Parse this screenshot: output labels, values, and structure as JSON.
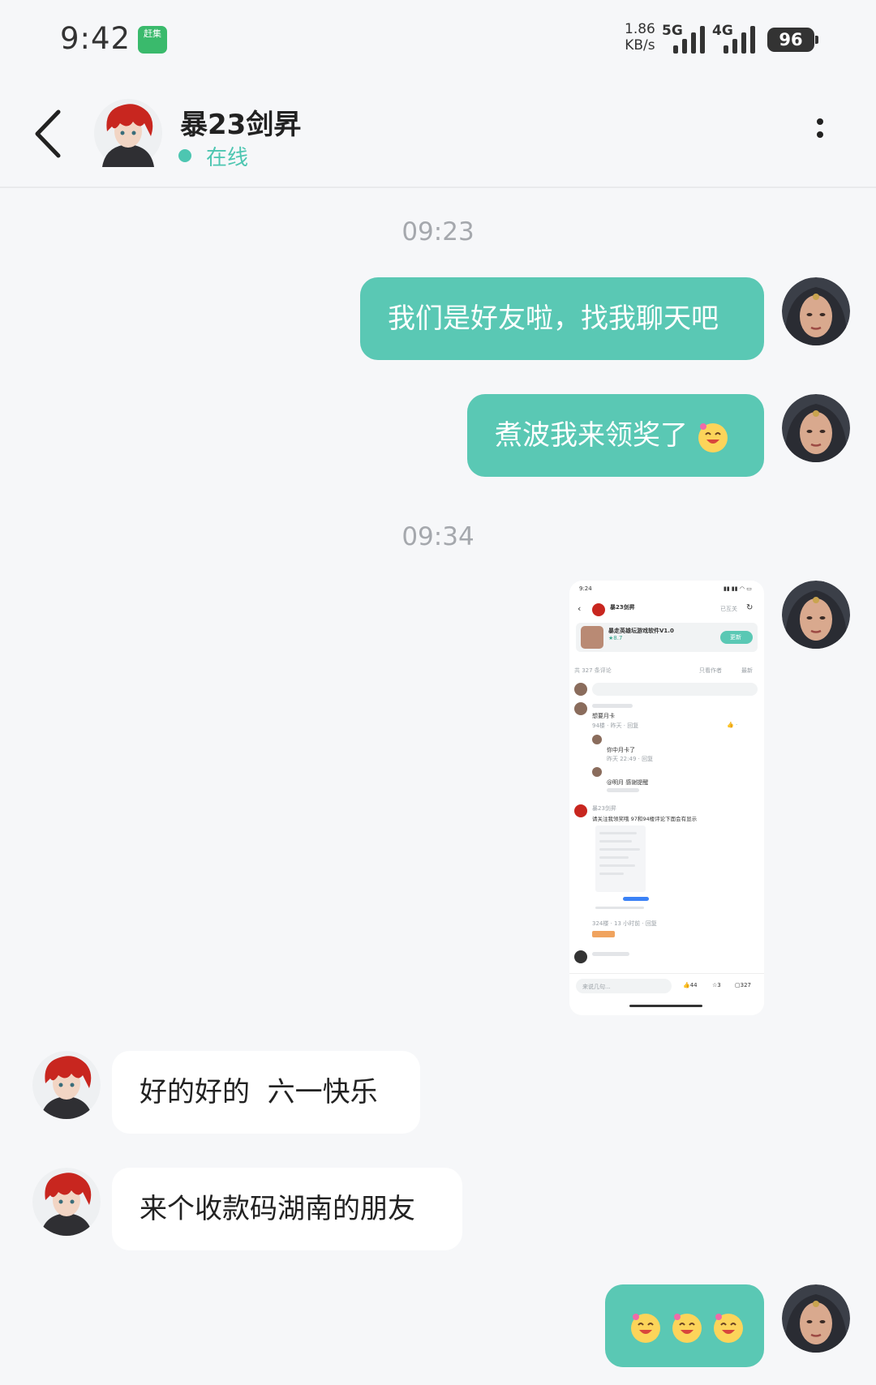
{
  "status_bar": {
    "time": "9:42",
    "app_badge_text": "赶集",
    "net_speed_value": "1.86",
    "net_speed_unit": "KB/s",
    "network1": "5G",
    "network2": "4G",
    "battery": "96"
  },
  "header": {
    "contact_name": "暴23剑昇",
    "status": "在线"
  },
  "messages": {
    "time1": "09:23",
    "m1": "我们是好友啦，找我聊天吧",
    "m2": "煮波我来领奖了",
    "time2": "09:34",
    "m4": "好的好的  六一快乐",
    "m5": "来个收款码湖南的朋友"
  },
  "shared_screenshot": {
    "time": "9:24",
    "author": "暴23剑昇",
    "followed": "已互关",
    "software_title": "暴走英雄坛游戏软件V1.0",
    "rating": "★8.7",
    "update_button": "更新",
    "comments_count_label": "共 327 条评论",
    "only_author": "只看作者",
    "newest": "最新",
    "input_placeholder": "来说几句...",
    "c1_text": "想要月卡",
    "c1_meta": "94楼 · 昨天 · 回复",
    "c2_text": "你中月卡了",
    "c2_meta": "昨天 22:49 · 回复",
    "c3_text": "@明月 感谢提醒",
    "c4_author": "暴23剑昇",
    "c4_text": "请关注我领奖哦 97和94楼评论下面会有显示",
    "c4_meta": "324楼 · 13 小时前 · 回复",
    "likes": "44",
    "stars": "3",
    "comments": "327"
  },
  "colors": {
    "accent": "#5ac8b4",
    "background": "#f6f7f9",
    "timestamp": "#a5a8ad"
  }
}
